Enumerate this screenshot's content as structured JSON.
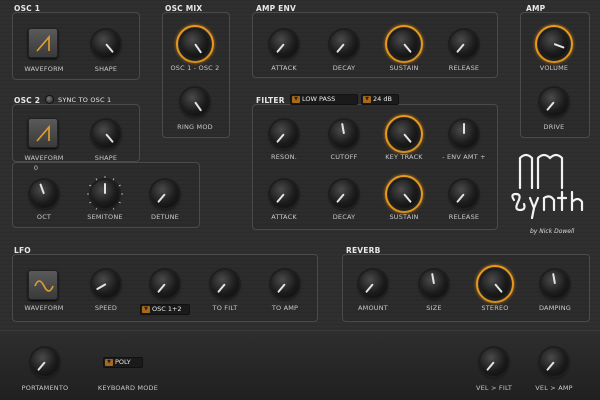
{
  "osc1": {
    "title": "OSC 1",
    "waveform": "WAVEFORM",
    "shape": "SHAPE"
  },
  "osc2": {
    "title": "OSC 2",
    "sync": "SYNC TO OSC 1",
    "waveform": "WAVEFORM",
    "shape": "SHAPE",
    "oct": "OCT",
    "semitone": "SEMITONE",
    "detune": "DETUNE",
    "oct_value": "0"
  },
  "oscmix": {
    "title": "OSC MIX",
    "mix": "OSC 1 - OSC 2",
    "ringmod": "RING MOD"
  },
  "ampenv": {
    "title": "AMP ENV",
    "attack": "ATTACK",
    "decay": "DECAY",
    "sustain": "SUSTAIN",
    "release": "RELEASE"
  },
  "amp": {
    "title": "AMP",
    "volume": "VOLUME",
    "drive": "DRIVE"
  },
  "filter": {
    "title": "FILTER",
    "type": "LOW PASS",
    "slope": "24 dB",
    "reson": "RESON.",
    "cutoff": "CUTOFF",
    "keytrack": "KEY TRACK",
    "envamt": "- ENV AMT +",
    "attack": "ATTACK",
    "decay": "DECAY",
    "sustain": "SUSTAIN",
    "release": "RELEASE"
  },
  "lfo": {
    "title": "LFO",
    "waveform": "WAVEFORM",
    "speed": "SPEED",
    "dest": "OSC 1+2",
    "tofilt": "TO FILT",
    "toamp": "TO AMP"
  },
  "reverb": {
    "title": "REVERB",
    "amount": "AMOUNT",
    "size": "SIZE",
    "stereo": "STEREO",
    "damping": "DAMPING"
  },
  "footer": {
    "portamento": "PORTAMENTO",
    "keyboard_mode_label": "KEYBOARD MODE",
    "keyboard_mode": "POLY",
    "velfilt": "VEL > FILT",
    "velamp": "VEL > AMP"
  },
  "logo": {
    "credit": "by Nick Dowell"
  },
  "colors": {
    "accent": "#e79a1f",
    "panel_border": "#4a4a4a",
    "label": "#c9c9c9"
  },
  "icons": {
    "saw": "sawtooth-wave-icon",
    "sine": "sine-wave-icon",
    "dropdown": "dropdown-arrow-icon"
  }
}
